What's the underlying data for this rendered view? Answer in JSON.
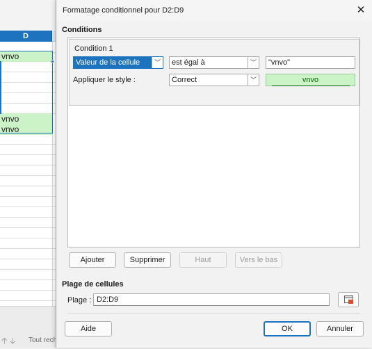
{
  "spreadsheet": {
    "column_header": "D",
    "cells": [
      {
        "row": 2,
        "value": "vnvo"
      },
      {
        "row": 8,
        "value": "vnvo"
      },
      {
        "row": 9,
        "value": "vnvo"
      }
    ],
    "status_find_all": "Tout rech"
  },
  "dialog": {
    "title": "Formatage conditionnel pour D2:D9",
    "conditions_heading": "Conditions",
    "condition": {
      "label": "Condition 1",
      "type_value": "Valeur de la cellule",
      "operator_value": "est égal à",
      "value_input": "\"vnvo\"",
      "apply_style_label": "Appliquer le style :",
      "style_value": "Correct",
      "preview_text": "vnvo"
    },
    "buttons": {
      "add": "Ajouter",
      "remove": "Supprimer",
      "up": "Haut",
      "down": "Vers le bas",
      "help": "Aide",
      "ok": "OK",
      "cancel": "Annuler"
    },
    "range_heading": "Plage de cellules",
    "range_label": "Plage :",
    "range_value": "D2:D9"
  },
  "colors": {
    "accent": "#1e73be",
    "good_style_bg": "#ccf3c8",
    "good_style_text": "#006100"
  }
}
